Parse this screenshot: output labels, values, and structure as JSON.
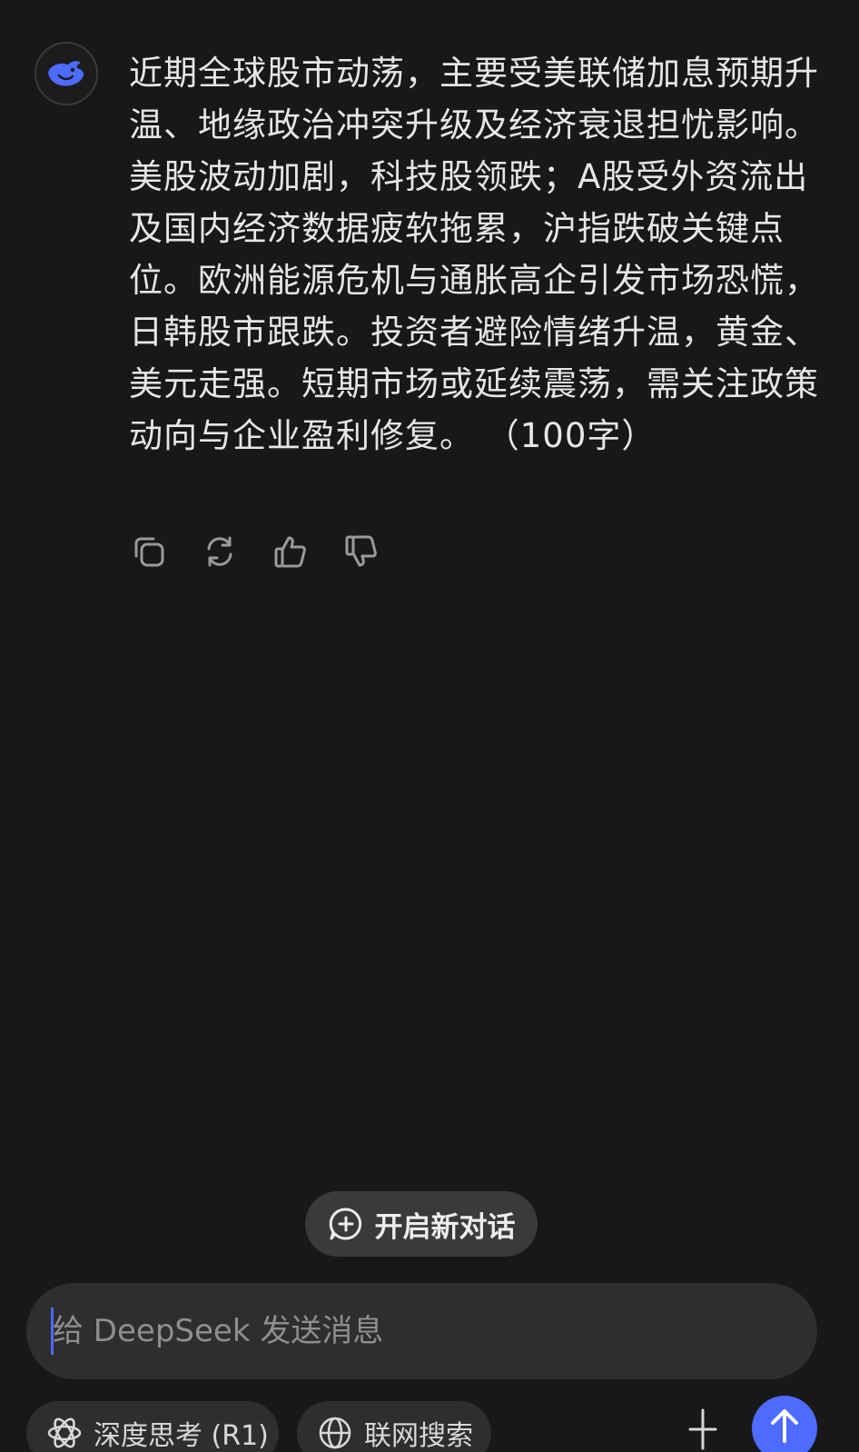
{
  "assistant": {
    "name": "DeepSeek",
    "accent_color": "#4d6bfe",
    "avatar_icon": "deepseek-whale-icon"
  },
  "message": {
    "text": "近期全球股市动荡，主要受美联储加息预期升温、地缘政治冲突升级及经济衰退担忧影响。美股波动加剧，科技股领跌；A股受外资流出及国内经济数据疲软拖累，沪指跌破关键点位。欧洲能源危机与通胀高企引发市场恐慌，日韩股市跟跌。投资者避险情绪升温，黄金、美元走强。短期市场或延续震荡，需关注政策动向与企业盈利修复。 （100字）"
  },
  "actions": {
    "items": [
      {
        "icon": "copy-icon"
      },
      {
        "icon": "regenerate-icon"
      },
      {
        "icon": "thumbs-up-icon"
      },
      {
        "icon": "thumbs-down-icon"
      }
    ]
  },
  "new_chat": {
    "label": "开启新对话",
    "icon": "new-chat-plus-icon"
  },
  "composer": {
    "placeholder": "给 DeepSeek 发送消息",
    "value": ""
  },
  "chips": {
    "deep_think": {
      "label": "深度思考 (R1)",
      "icon": "atom-icon"
    },
    "web_search": {
      "label": "联网搜索",
      "icon": "globe-icon"
    }
  },
  "attach": {
    "icon": "attach-icon"
  },
  "send": {
    "icon": "send-arrow-icon"
  }
}
